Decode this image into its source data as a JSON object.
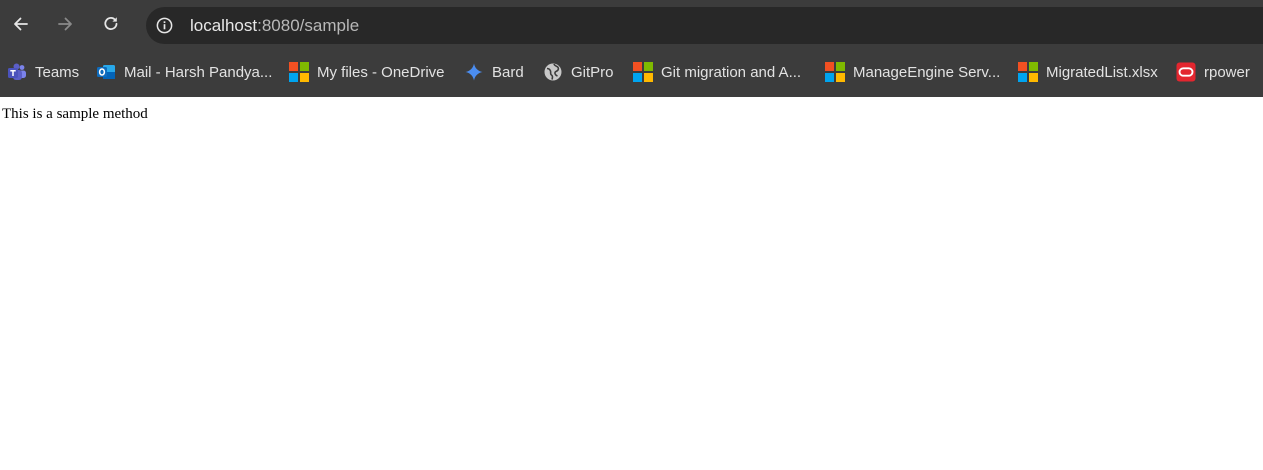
{
  "address_bar": {
    "host": "localhost",
    "path": ":8080/sample"
  },
  "bookmarks": [
    {
      "label": "Teams",
      "icon": "teams-icon"
    },
    {
      "label": "Mail - Harsh Pandya...",
      "icon": "outlook-icon"
    },
    {
      "label": "My files - OneDrive",
      "icon": "microsoft-icon"
    },
    {
      "label": "Bard",
      "icon": "bard-sparkle-icon"
    },
    {
      "label": "GitPro",
      "icon": "globe-icon"
    },
    {
      "label": "Git migration and A...",
      "icon": "microsoft-icon"
    },
    {
      "label": "ManageEngine Serv...",
      "icon": "microsoft-icon"
    },
    {
      "label": "MigratedList.xlsx",
      "icon": "microsoft-icon"
    },
    {
      "label": "rpower",
      "icon": "oracle-icon"
    }
  ],
  "page": {
    "body_text": "This is a sample method"
  },
  "colors": {
    "chrome_bg": "#3c3c3c",
    "omnibox_bg": "#282828",
    "ms_red": "#f25022",
    "ms_green": "#7fba00",
    "ms_blue": "#00a4ef",
    "ms_yellow": "#ffb900",
    "oracle_red": "#e3262f",
    "teams_purple": "#5b5fc7",
    "outlook_blue": "#0f6cbd",
    "bard_blue": "#4b8df0"
  }
}
